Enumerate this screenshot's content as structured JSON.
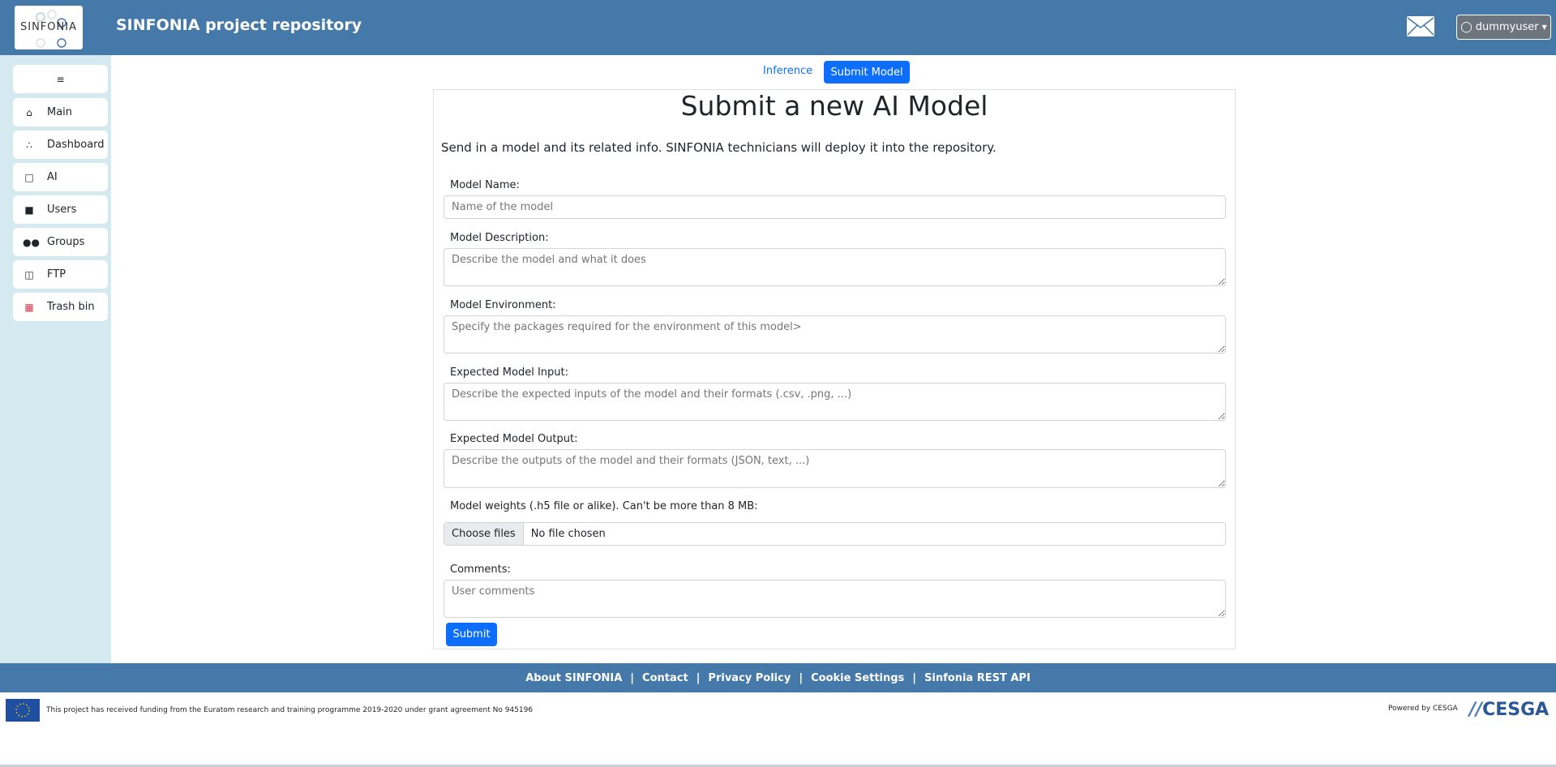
{
  "header": {
    "logo_text": "SINFONIA",
    "title": "SINFONIA project repository",
    "user": "dummyuser"
  },
  "sidebar": {
    "items": [
      {
        "label": "Main",
        "icon": "home-icon"
      },
      {
        "label": "Dashboard",
        "icon": "sitemap-icon"
      },
      {
        "label": "AI",
        "icon": "file-icon"
      },
      {
        "label": "Users",
        "icon": "user-list-icon"
      },
      {
        "label": "Groups",
        "icon": "group-icon"
      },
      {
        "label": "FTP",
        "icon": "database-icon"
      },
      {
        "label": "Trash bin",
        "icon": "trash-icon"
      }
    ]
  },
  "tabs": {
    "inference": "Inference",
    "submit_model": "Submit Model"
  },
  "form": {
    "title": "Submit a new AI Model",
    "intro": "Send in a model and its related info. SINFONIA technicians will deploy it into the repository.",
    "name_label": "Model Name:",
    "name_ph": "Name of the model",
    "desc_label": "Model Description:",
    "desc_ph": "Describe the model and what it does",
    "env_label": "Model Environment:",
    "env_ph": "Specify the packages required for the environment of this model>",
    "input_label": "Expected Model Input:",
    "input_ph": "Describe the expected inputs of the model and their formats (.csv, .png, ...)",
    "output_label": "Expected Model Output:",
    "output_ph": "Describe the outputs of the model and their formats (JSON, text, ...)",
    "weights_label": "Model weights (.h5 file or alike). Can't be more than 8 MB:",
    "choose_files": "Choose files",
    "no_file": "No file chosen",
    "comments_label": "Comments:",
    "comments_ph": "User comments",
    "submit": "Submit"
  },
  "footer": {
    "links": [
      "About SINFONIA",
      "Contact",
      "Privacy Policy",
      "Cookie Settings",
      "Sinfonia REST API"
    ],
    "funding": "This project has received funding from the Euratom research and training programme 2019-2020 under grant agreement No 945196",
    "powered": "Powered by CESGA",
    "cesga_logo": "CESGA"
  },
  "colors": {
    "header": "#4479aa",
    "sidebar": "#d5e9f0",
    "primary": "#0d6efd"
  }
}
